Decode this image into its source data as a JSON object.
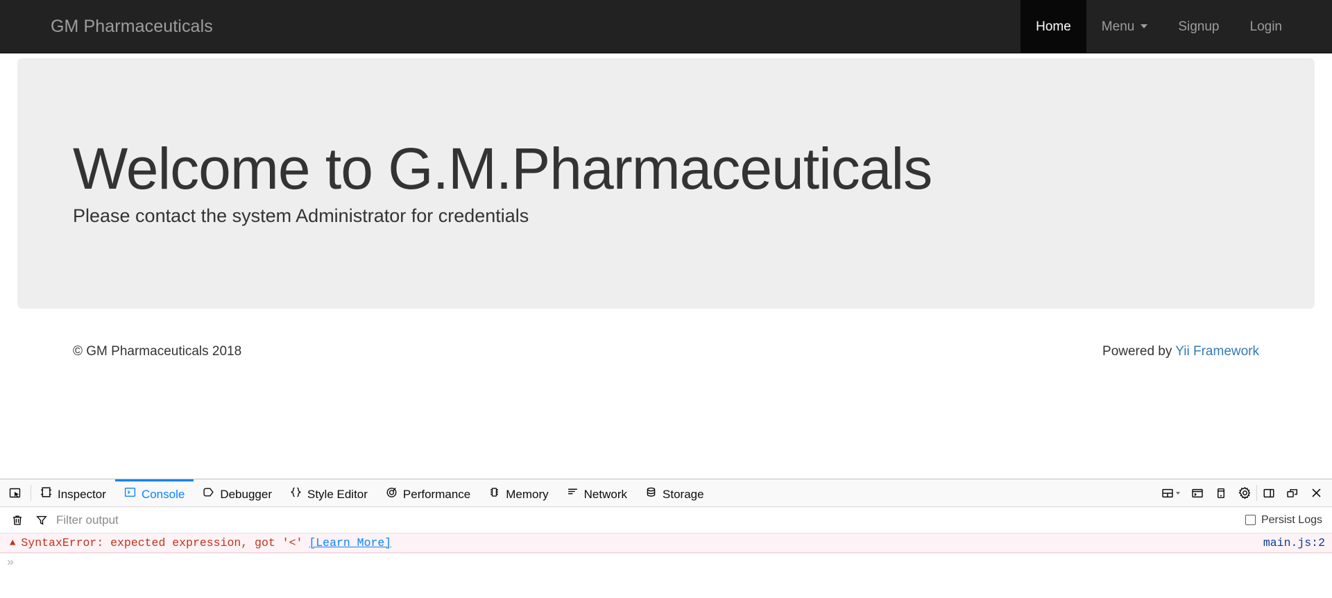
{
  "navbar": {
    "brand": "GM Pharmaceuticals",
    "items": [
      {
        "label": "Home",
        "active": true,
        "caret": false
      },
      {
        "label": "Menu",
        "active": false,
        "caret": true
      },
      {
        "label": "Signup",
        "active": false,
        "caret": false
      },
      {
        "label": "Login",
        "active": false,
        "caret": false
      }
    ]
  },
  "jumbotron": {
    "heading": "Welcome to G.M.Pharmaceuticals",
    "subheading": "Please contact the system Administrator for credentials"
  },
  "footer": {
    "copyright": "© GM Pharmaceuticals 2018",
    "powered_prefix": "Powered by ",
    "powered_link": "Yii Framework"
  },
  "devtools": {
    "picker_icon": "element-picker-icon",
    "tabs": [
      {
        "label": "Inspector",
        "icon": "inspector-icon",
        "selected": false
      },
      {
        "label": "Console",
        "icon": "console-icon",
        "selected": true
      },
      {
        "label": "Debugger",
        "icon": "debugger-icon",
        "selected": false
      },
      {
        "label": "Style Editor",
        "icon": "style-editor-icon",
        "selected": false
      },
      {
        "label": "Performance",
        "icon": "performance-icon",
        "selected": false
      },
      {
        "label": "Memory",
        "icon": "memory-icon",
        "selected": false
      },
      {
        "label": "Network",
        "icon": "network-icon",
        "selected": false
      },
      {
        "label": "Storage",
        "icon": "storage-icon",
        "selected": false
      }
    ],
    "toolbar_icons": [
      "responsive-layout-icon",
      "split-console-icon",
      "responsive-design-mode-icon",
      "settings-gear-icon",
      "sidebar-toggle-icon",
      "detach-window-icon",
      "close-icon"
    ],
    "filter": {
      "trash_icon": "trash-icon",
      "funnel_icon": "funnel-icon",
      "placeholder": "Filter output",
      "value": "",
      "persist_label": "Persist Logs",
      "persist_checked": false
    },
    "messages": [
      {
        "level": "error",
        "icon": "warning-triangle-icon",
        "text": "SyntaxError: expected expression, got '<'",
        "learn_more": "[Learn More]",
        "source": "main.js:2"
      }
    ],
    "input": {
      "prompt": "»",
      "value": ""
    }
  },
  "colors": {
    "navbar_bg": "#222222",
    "navbar_active_bg": "#080808",
    "navbar_text": "#9d9d9d",
    "jumbotron_bg": "#eeeeee",
    "link": "#337ab7",
    "devtools_accent": "#0a84ff",
    "error_text": "#c0341d",
    "error_bg": "#fdf2f5"
  }
}
